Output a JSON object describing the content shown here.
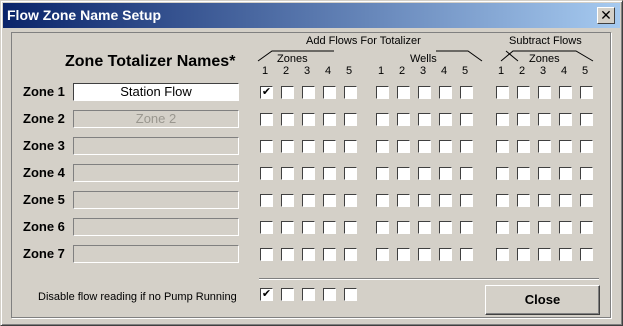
{
  "window": {
    "title": "Flow Zone Name Setup",
    "close_glyph": "✕"
  },
  "headers": {
    "zone_names_title": "Zone Totalizer Names*",
    "add_flows": "Add Flows For Totalizer",
    "add_zones": "Zones",
    "wells": "Wells",
    "subtract_flows": "Subtract Flows",
    "subtract_zones": "Zones",
    "nums": [
      "1",
      "2",
      "3",
      "4",
      "5"
    ]
  },
  "zones": [
    {
      "label": "Zone 1",
      "value": "Station Flow",
      "add_zones": [
        true,
        false,
        false,
        false,
        false
      ],
      "wells": [
        false,
        false,
        false,
        false,
        false
      ],
      "subtract": [
        false,
        false,
        false,
        false,
        false
      ]
    },
    {
      "label": "Zone 2",
      "value": "Zone 2",
      "add_zones": [
        false,
        false,
        false,
        false,
        false
      ],
      "wells": [
        false,
        false,
        false,
        false,
        false
      ],
      "subtract": [
        false,
        false,
        false,
        false,
        false
      ]
    },
    {
      "label": "Zone 3",
      "value": "",
      "add_zones": [
        false,
        false,
        false,
        false,
        false
      ],
      "wells": [
        false,
        false,
        false,
        false,
        false
      ],
      "subtract": [
        false,
        false,
        false,
        false,
        false
      ]
    },
    {
      "label": "Zone 4",
      "value": "",
      "add_zones": [
        false,
        false,
        false,
        false,
        false
      ],
      "wells": [
        false,
        false,
        false,
        false,
        false
      ],
      "subtract": [
        false,
        false,
        false,
        false,
        false
      ]
    },
    {
      "label": "Zone 5",
      "value": "",
      "add_zones": [
        false,
        false,
        false,
        false,
        false
      ],
      "wells": [
        false,
        false,
        false,
        false,
        false
      ],
      "subtract": [
        false,
        false,
        false,
        false,
        false
      ]
    },
    {
      "label": "Zone 6",
      "value": "",
      "add_zones": [
        false,
        false,
        false,
        false,
        false
      ],
      "wells": [
        false,
        false,
        false,
        false,
        false
      ],
      "subtract": [
        false,
        false,
        false,
        false,
        false
      ]
    },
    {
      "label": "Zone 7",
      "value": "",
      "add_zones": [
        false,
        false,
        false,
        false,
        false
      ],
      "wells": [
        false,
        false,
        false,
        false,
        false
      ],
      "subtract": [
        false,
        false,
        false,
        false,
        false
      ]
    }
  ],
  "disable": {
    "label": "Disable flow reading if no Pump Running",
    "checks": [
      true,
      false,
      false,
      false,
      false
    ]
  },
  "close_button": "Close"
}
